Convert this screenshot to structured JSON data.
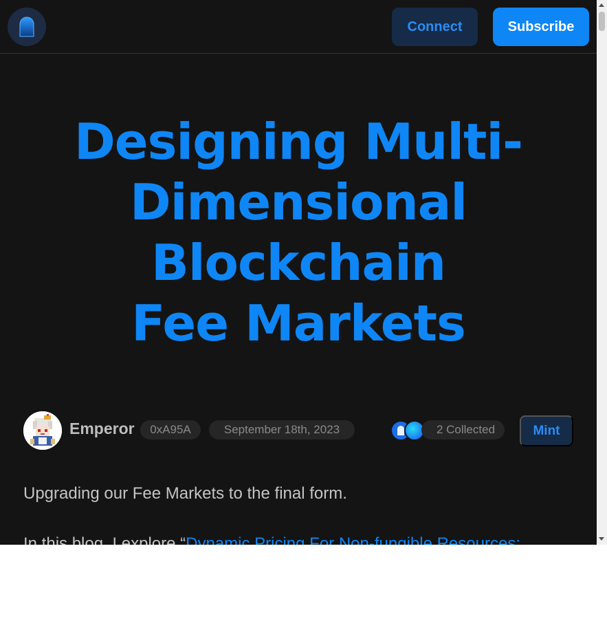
{
  "header": {
    "connect_label": "Connect",
    "subscribe_label": "Subscribe"
  },
  "article": {
    "title_lines": [
      "Designing Multi-",
      "Dimensional",
      "Blockchain",
      "Fee Markets"
    ],
    "author": "Emperor",
    "address": "0xA95A",
    "date": "September 18th, 2023",
    "collected": "2 Collected",
    "mint_label": "Mint",
    "lead": "Upgrading our Fee Markets to the final form.",
    "para_prefix": "In this blog, I explore “",
    "para_link": "Dynamic Pricing For Non-fungible Resources:"
  },
  "colors": {
    "accent": "#0f86f5",
    "background": "#141414"
  },
  "icons": {
    "logo": "mirror-arch-logo",
    "avatar": "pixel-avatar"
  }
}
